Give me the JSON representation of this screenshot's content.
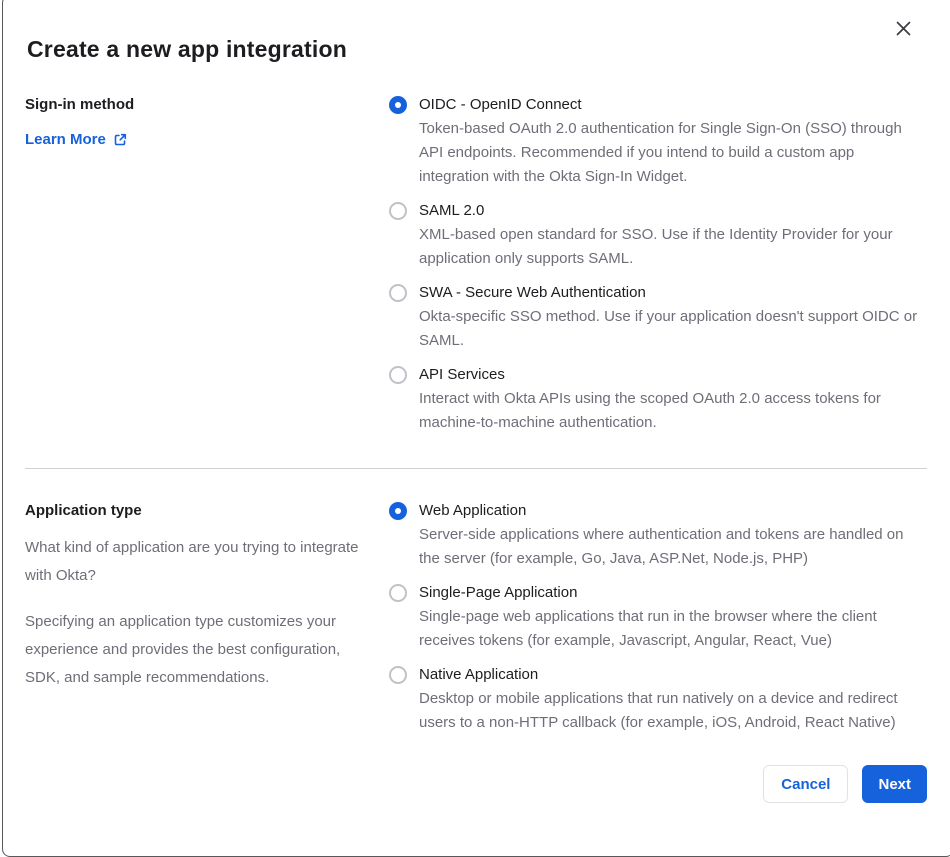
{
  "dialog": {
    "title": "Create a new app integration"
  },
  "colors": {
    "accent_blue": "#1662dd",
    "text_dark": "#1d1d21",
    "text_gray": "#6e6e78",
    "radio_off_border": "#c1c1c8",
    "divider": "#cfcfd4"
  },
  "icons": {
    "close": "x-icon",
    "learn_more": "external-link-icon"
  },
  "signin_section": {
    "heading": "Sign-in method",
    "link_label": "Learn More",
    "options": [
      {
        "label": "OIDC - OpenID Connect",
        "description": "Token-based OAuth 2.0 authentication for Single Sign-On (SSO) through API endpoints. Recommended if you intend to build a custom app integration with the Okta Sign-In Widget.",
        "selected": true
      },
      {
        "label": "SAML 2.0",
        "description": "XML-based open standard for SSO. Use if the Identity Provider for your application only supports SAML.",
        "selected": false
      },
      {
        "label": "SWA - Secure Web Authentication",
        "description": "Okta-specific SSO method. Use if your application doesn't support OIDC or SAML.",
        "selected": false
      },
      {
        "label": "API Services",
        "description": "Interact with Okta APIs using the scoped OAuth 2.0 access tokens for machine-to-machine authentication.",
        "selected": false
      }
    ]
  },
  "apptype_section": {
    "heading": "Application type",
    "paragraphs": [
      "What kind of application are you trying to integrate with Okta?",
      "Specifying an application type customizes your experience and provides the best configuration, SDK, and sample recommendations."
    ],
    "options": [
      {
        "label": "Web Application",
        "description": "Server-side applications where authentication and tokens are handled on the server (for example, Go, Java, ASP.Net, Node.js, PHP)",
        "selected": true
      },
      {
        "label": "Single-Page Application",
        "description": "Single-page web applications that run in the browser where the client receives tokens (for example, Javascript, Angular, React, Vue)",
        "selected": false
      },
      {
        "label": "Native Application",
        "description": "Desktop or mobile applications that run natively on a device and redirect users to a non-HTTP callback (for example, iOS, Android, React Native)",
        "selected": false
      }
    ]
  },
  "footer": {
    "cancel_label": "Cancel",
    "next_label": "Next"
  }
}
